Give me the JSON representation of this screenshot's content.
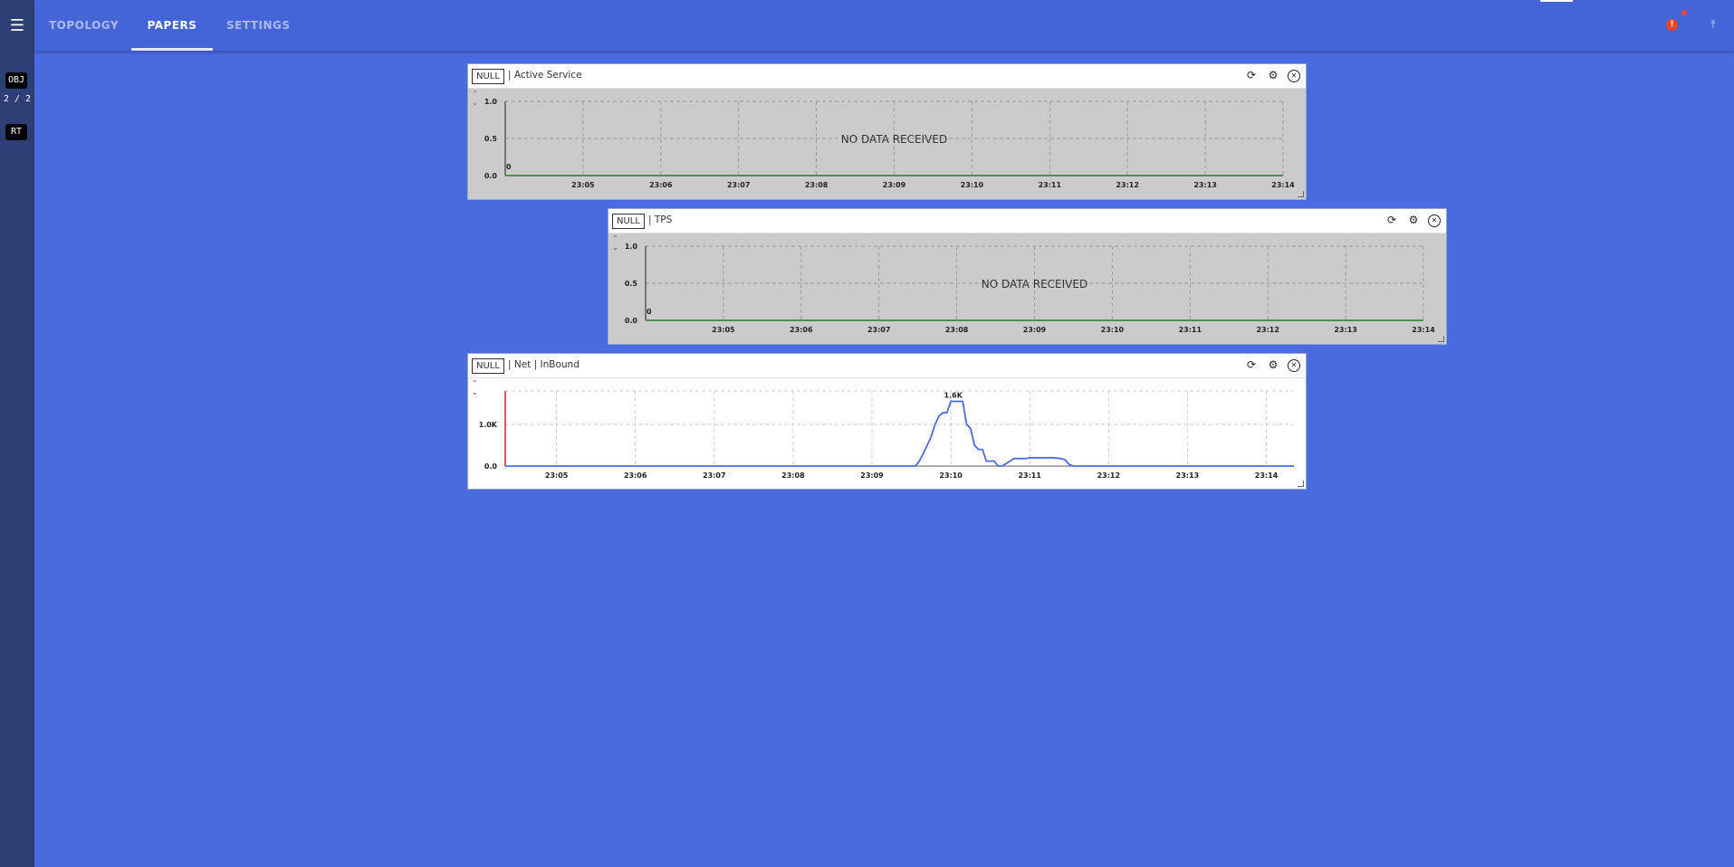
{
  "sidebar": {
    "menu_icon": "hamburger-icon",
    "obj_label": "OBJ",
    "count": "2 / 2",
    "rt_label": "RT"
  },
  "nav": {
    "tabs": [
      {
        "label": "TOPOLOGY",
        "active": false
      },
      {
        "label": "PAPERS",
        "active": true
      },
      {
        "label": "SETTINGS",
        "active": false
      }
    ],
    "alert_icon": "alert-icon",
    "pin_icon": "pin-icon"
  },
  "colors": {
    "background": "#4a6bdf",
    "sidebar": "#2e3f76",
    "line": "#4a6bdf",
    "zero_line": "#2a7a2a",
    "marker_red": "#cc2222"
  },
  "panels": [
    {
      "null_label": "NULL",
      "title": "| Active Service",
      "message": "NO DATA RECEIVED",
      "zero_marker": "0",
      "chart_data": {
        "type": "line",
        "title": "",
        "x": [
          "23:05",
          "23:06",
          "23:07",
          "23:08",
          "23:09",
          "23:10",
          "23:11",
          "23:12",
          "23:13",
          "23:14"
        ],
        "yticks": [
          "1.0",
          "0.5",
          "0.0"
        ],
        "ylim": [
          0,
          1
        ],
        "series": [],
        "grid": true
      }
    },
    {
      "null_label": "NULL",
      "title": "| TPS",
      "message": "NO DATA RECEIVED",
      "zero_marker": "0",
      "chart_data": {
        "type": "line",
        "title": "",
        "x": [
          "23:05",
          "23:06",
          "23:07",
          "23:08",
          "23:09",
          "23:10",
          "23:11",
          "23:12",
          "23:13",
          "23:14"
        ],
        "yticks": [
          "1.0",
          "0.5",
          "0.0"
        ],
        "ylim": [
          0,
          1
        ],
        "series": [],
        "grid": true
      }
    },
    {
      "null_label": "NULL",
      "title": "| Net | InBound",
      "peak_label": "1.6K",
      "chart_data": {
        "type": "line",
        "title": "",
        "x_ticks": [
          "23:05",
          "23:06",
          "23:07",
          "23:08",
          "23:09",
          "23:10",
          "23:11",
          "23:12",
          "23:13",
          "23:14"
        ],
        "yticks": [
          "1.0K",
          "0.0"
        ],
        "ylim": [
          0,
          1800
        ],
        "grid": true,
        "series": [
          {
            "x_minutes": [
              4.35,
              9.55,
              9.6,
              9.65,
              9.7,
              9.75,
              9.8,
              9.85,
              9.9,
              9.95,
              10.0,
              10.05,
              10.1,
              10.15,
              10.2,
              10.25,
              10.3,
              10.35,
              10.4,
              10.45,
              10.5,
              10.55,
              10.6,
              10.65,
              10.7,
              10.75,
              10.8,
              10.85,
              10.9,
              10.95,
              11.0,
              11.1,
              11.2,
              11.3,
              11.4,
              11.45,
              11.5,
              11.55,
              14.35
            ],
            "values": [
              0,
              0,
              120,
              300,
              500,
              700,
              1000,
              1200,
              1280,
              1280,
              1550,
              1550,
              1550,
              1550,
              1000,
              900,
              500,
              400,
              400,
              120,
              120,
              120,
              0,
              0,
              60,
              120,
              180,
              180,
              180,
              180,
              200,
              200,
              200,
              200,
              180,
              150,
              40,
              0,
              0
            ]
          }
        ]
      }
    }
  ]
}
